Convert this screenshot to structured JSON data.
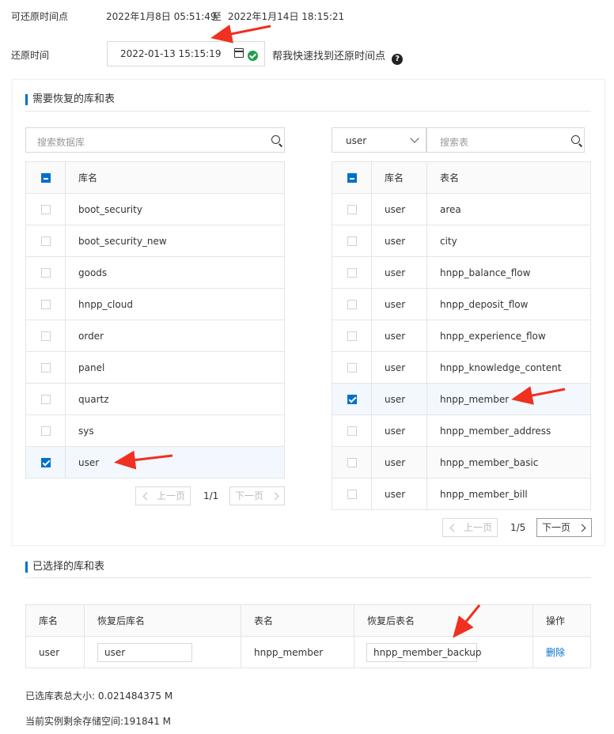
{
  "restore_range": {
    "label": "可还原时间点",
    "start": "2022年1月8日 05:51:49",
    "sep": "至",
    "end": "2022年1月14日 18:15:21"
  },
  "restore_time": {
    "label": "还原时间",
    "value": "2022-01-13 15:15:19",
    "help_link": "帮我快速找到还原时间点",
    "help_icon": "?"
  },
  "db_section": {
    "title": "需要恢复的库和表",
    "db_search_placeholder": "搜索数据库",
    "db_header": "库名",
    "databases": [
      {
        "name": "boot_security",
        "checked": false
      },
      {
        "name": "boot_security_new",
        "checked": false
      },
      {
        "name": "goods",
        "checked": false
      },
      {
        "name": "hnpp_cloud",
        "checked": false
      },
      {
        "name": "order",
        "checked": false
      },
      {
        "name": "panel",
        "checked": false
      },
      {
        "name": "quartz",
        "checked": false
      },
      {
        "name": "sys",
        "checked": false
      },
      {
        "name": "user",
        "checked": true
      }
    ],
    "db_pager": {
      "prev": "上一页",
      "page": "1/1",
      "next": "下一页"
    },
    "db_select_value": "user",
    "table_search_placeholder": "搜索表",
    "table_headers": {
      "db": "库名",
      "table": "表名"
    },
    "tables": [
      {
        "db": "user",
        "name": "area",
        "checked": false
      },
      {
        "db": "user",
        "name": "city",
        "checked": false
      },
      {
        "db": "user",
        "name": "hnpp_balance_flow",
        "checked": false
      },
      {
        "db": "user",
        "name": "hnpp_deposit_flow",
        "checked": false
      },
      {
        "db": "user",
        "name": "hnpp_experience_flow",
        "checked": false
      },
      {
        "db": "user",
        "name": "hnpp_knowledge_content",
        "checked": false
      },
      {
        "db": "user",
        "name": "hnpp_member",
        "checked": true
      },
      {
        "db": "user",
        "name": "hnpp_member_address",
        "checked": false
      },
      {
        "db": "user",
        "name": "hnpp_member_basic",
        "checked": false
      },
      {
        "db": "user",
        "name": "hnpp_member_bill",
        "checked": false
      }
    ],
    "table_pager": {
      "prev": "上一页",
      "page": "1/5",
      "next": "下一页"
    }
  },
  "selected_section": {
    "title": "已选择的库和表",
    "headers": [
      "库名",
      "恢复后库名",
      "表名",
      "恢复后表名",
      "操作"
    ],
    "rows": [
      {
        "db": "user",
        "new_db": "user",
        "table": "hnpp_member",
        "new_table": "hnpp_member_backup",
        "action": "删除"
      }
    ]
  },
  "footer": {
    "total_size": "已选库表总大小: 0.021484375 M",
    "remaining": "当前实例剩余存储空间:191841 M"
  },
  "colors": {
    "accent": "#0070cc",
    "annotation_arrow": "#f03020",
    "success": "#1e9e4d"
  }
}
